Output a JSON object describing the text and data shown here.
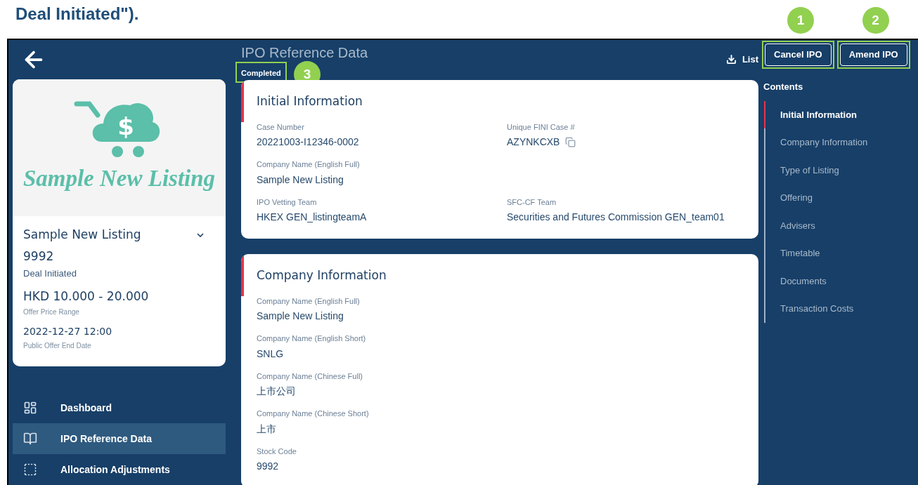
{
  "doc_heading": "Deal Initiated\").",
  "header": {
    "page_title": "IPO Reference Data",
    "status_badge": "Completed",
    "status_callout": "3",
    "list_link": "List",
    "buttons": [
      {
        "label": "Cancel IPO",
        "callout": "1"
      },
      {
        "label": "Amend IPO",
        "callout": "2"
      }
    ]
  },
  "listing_card": {
    "logo_symbol": "$",
    "logo_text": "Sample New Listing",
    "name": "Sample New Listing",
    "expanded": false,
    "stock_code": "9992",
    "status": "Deal Initiated",
    "price": "HKD 10.000 - 20.000",
    "price_label": "Offer Price Range",
    "date": "2022-12-27 12:00",
    "date_label": "Public Offer End Date"
  },
  "nav": [
    {
      "kind": "dashboard",
      "label": "Dashboard",
      "selected": false
    },
    {
      "kind": "book",
      "label": "IPO Reference Data",
      "selected": true
    },
    {
      "kind": "allocation",
      "label": "Allocation Adjustments",
      "selected": false
    }
  ],
  "sections": [
    {
      "title": "Initial Information",
      "rows": [
        [
          {
            "label": "Case Number",
            "value": "20221003-I12346-0002",
            "copyable": false
          },
          {
            "label": "Unique FINI Case #",
            "value": "AZYNKCXB",
            "copyable": true
          }
        ],
        [
          {
            "label": "Company Name (English Full)",
            "value": "Sample New Listing",
            "copyable": false
          }
        ],
        [
          {
            "label": "IPO Vetting Team",
            "value": "HKEX GEN_listingteamA",
            "copyable": false
          },
          {
            "label": "SFC-CF Team",
            "value": "Securities and Futures Commission GEN_team01",
            "copyable": false
          }
        ]
      ]
    },
    {
      "title": "Company Information",
      "rows": [
        [
          {
            "label": "Company Name (English Full)",
            "value": "Sample New Listing",
            "copyable": false
          }
        ],
        [
          {
            "label": "Company Name (English Short)",
            "value": "SNLG",
            "copyable": false
          }
        ],
        [
          {
            "label": "Company Name (Chinese Full)",
            "value": "上市公司",
            "copyable": false
          }
        ],
        [
          {
            "label": "Company Name (Chinese Short)",
            "value": "上市",
            "copyable": false
          }
        ],
        [
          {
            "label": "Stock Code",
            "value": "9992",
            "copyable": false
          }
        ]
      ]
    }
  ],
  "contents": {
    "title": "Contents",
    "items": [
      {
        "label": "Initial Information",
        "selected": true
      },
      {
        "label": "Company Information",
        "selected": false
      },
      {
        "label": "Type of Listing",
        "selected": false
      },
      {
        "label": "Offering",
        "selected": false
      },
      {
        "label": "Advisers",
        "selected": false
      },
      {
        "label": "Timetable",
        "selected": false
      },
      {
        "label": "Documents",
        "selected": false
      },
      {
        "label": "Transaction Costs",
        "selected": false
      }
    ]
  }
}
